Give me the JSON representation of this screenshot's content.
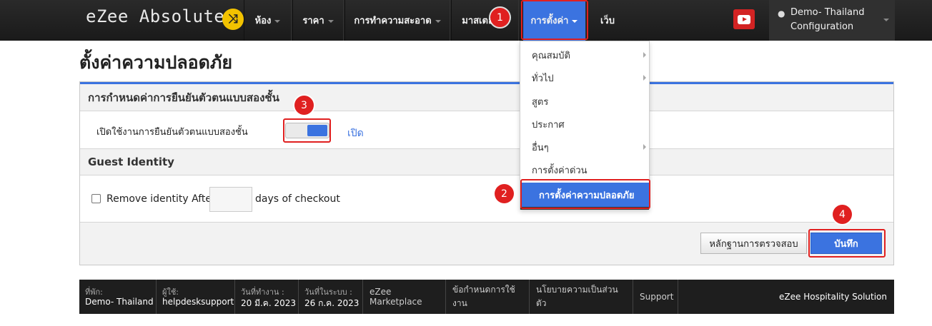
{
  "navbar": {
    "brand": "eZee Absolute",
    "brand_badge_icon": "shuffle-icon",
    "items": [
      {
        "label": "ห้อง",
        "has_caret": true
      },
      {
        "label": "ราคา",
        "has_caret": true
      },
      {
        "label": "การทำความสะอาด",
        "has_caret": true
      },
      {
        "label": "มาสเตอร์",
        "has_caret": true
      },
      {
        "label": "การตั้งค่า",
        "has_caret": true,
        "active": true
      },
      {
        "label": "เว็บ",
        "has_caret": false
      }
    ],
    "youtube_icon": "youtube-icon",
    "user": {
      "name": "Demo- Thailand",
      "subtitle": "Configuration"
    }
  },
  "page": {
    "title": "ตั้งค่าความปลอดภัย"
  },
  "two_factor": {
    "section_title": "การกำหนดค่าการยืนยันตัวตนแบบสองชั้น",
    "enable_label": "เปิดใช้งานการยืนยันตัวตนแบบสองชั้น",
    "state_label": "เปิด",
    "enabled": true
  },
  "guest_identity": {
    "section_title": "Guest Identity",
    "remove_label": "Remove identity After",
    "days_value": "",
    "days_suffix": "days of checkout",
    "checked": false
  },
  "actions": {
    "audit_label": "หลักฐานการตรวจสอบ",
    "save_label": "บันทึก"
  },
  "dropdown": {
    "items": [
      {
        "label": "คุณสมบัติ",
        "submenu": true
      },
      {
        "label": "ทั่วไป",
        "submenu": true
      },
      {
        "label": "สูตร",
        "submenu": false
      },
      {
        "label": "ประกาศ",
        "submenu": false
      },
      {
        "label": "อื่นๆ",
        "submenu": true
      },
      {
        "label": "การตั้งค่าด่วน",
        "submenu": false
      },
      {
        "label": "การตั้งค่าความปลอดภัย",
        "submenu": false,
        "active": true
      }
    ]
  },
  "markers": [
    "1",
    "2",
    "3",
    "4"
  ],
  "footer": {
    "hotel_caption": "ที่พัก:",
    "hotel_value": "Demo- Thailand",
    "user_caption": "ผู้ใช้:",
    "user_value": "helpdesksupport",
    "workday_caption": "วันที่ทำงาน :",
    "workday_value": "20 มี.ค. 2023",
    "sysdate_caption": "วันที่ในระบบ :",
    "sysdate_value": "26 ก.ค. 2023",
    "links": [
      "eZee Marketplace",
      "ข้อกำหนดการใช้งาน",
      "นโยบายความเป็นส่วนตัว",
      "Support"
    ],
    "brand": "eZee Hospitality Solution"
  },
  "colors": {
    "accent": "#3b73e0",
    "annotation": "#e02020",
    "navbar": "#1f1f1f"
  }
}
